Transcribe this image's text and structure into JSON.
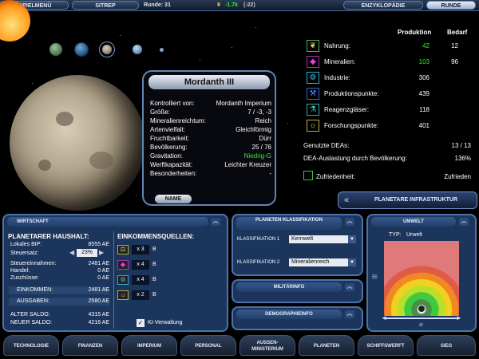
{
  "topbar": {
    "menu": "SPIELMENÜ",
    "sitrep": "SITREP",
    "round_label": "Runde: 31",
    "credits": "-1.7k",
    "credits_delta": "(-22)",
    "encyclopedia": "ENZYKLOPÄDIE",
    "round_button": "RUNDE"
  },
  "planet_info": {
    "name": "Mordanth III",
    "rows": [
      {
        "label": "Kontrolliert von:",
        "value": "Mordanth Imperium"
      },
      {
        "label": "Größe:",
        "value": "7 / -3, -3"
      },
      {
        "label": "Mineralienreichtum:",
        "value": "Reich"
      },
      {
        "label": "Artenvielfalt:",
        "value": "Gleichförmig"
      },
      {
        "label": "Fruchtbarkeit:",
        "value": "Dürr"
      },
      {
        "label": "Bevölkerung:",
        "value": "25 / 76"
      },
      {
        "label": "Gravitation:",
        "value": "Niedrig-G",
        "color": "#33ee33"
      },
      {
        "label": "Werftkapazität:",
        "value": "Leichter Kreuzer"
      },
      {
        "label": "Besonderheiten:",
        "value": "-"
      }
    ],
    "name_button": "NAME"
  },
  "production": {
    "col_production": "Produktion",
    "col_demand": "Bedarf",
    "rows": [
      {
        "icon": "food-icon",
        "label": "Nahrung:",
        "prod": "42",
        "demand": "12",
        "prod_color": "#33ee33"
      },
      {
        "icon": "minerals-icon",
        "label": "Mineralien:",
        "prod": "103",
        "demand": "96",
        "prod_color": "#33ee33"
      },
      {
        "icon": "industry-icon",
        "label": "Industrie:",
        "prod": "306",
        "demand": ""
      },
      {
        "icon": "production-points-icon",
        "label": "Produktionspunkte:",
        "prod": "439",
        "demand": ""
      },
      {
        "icon": "test-tubes-icon",
        "label": "Reagenzgläser:",
        "prod": "118",
        "demand": ""
      },
      {
        "icon": "research-icon",
        "label": "Forschungspunkte:",
        "prod": "401",
        "demand": ""
      }
    ],
    "dea_used_label": "Genutzte DEAs:",
    "dea_used_value": "13 / 13",
    "dea_load_label": "DEA-Auslastung durch Bevölkerung:",
    "dea_load_value": "136%",
    "satisfaction_label": "Zufriedenheit:",
    "satisfaction_value": "Zufrieden",
    "infra_button": "PLANETARE INFRASTRUKTUR"
  },
  "economy": {
    "header": "WIRTSCHAFT",
    "budget_title": "PLANETARER HAUSHALT:",
    "gdp_label": "Lokales BIP:",
    "gdp_value": "8555 AE",
    "tax_label": "Steuersatz:",
    "tax_value": "23%",
    "tax_income_label": "Steuereinnahmen:",
    "tax_income_value": "2481 AE",
    "trade_label": "Handel:",
    "trade_value": "0 AE",
    "subsidy_label": "Zuschüsse:",
    "subsidy_value": "0 AE",
    "income_label": "EINKOMMEN:",
    "income_value": "2481 AE",
    "expense_label": "AUSGABEN:",
    "expense_value": "2580 AE",
    "old_balance_label": "ALTER SALDO:",
    "old_balance_value": "4315 AE",
    "new_balance_label": "NEUER SALDO:",
    "new_balance_value": "4216 AE",
    "sources_title": "EINKOMMENSQUELLEN:",
    "sources": [
      {
        "icon": "trade-icon",
        "count": "x 3",
        "grade": "B"
      },
      {
        "icon": "minerals-icon",
        "count": "x 4",
        "grade": "B"
      },
      {
        "icon": "industry-icon",
        "count": "x 4",
        "grade": "B"
      },
      {
        "icon": "research-icon",
        "count": "x 2",
        "grade": "B"
      }
    ],
    "ai_label": "KI-Verwaltung"
  },
  "classification": {
    "header": "PLANETEN KLASSIFIKATION",
    "class1_label": "KLASSIFIKATION 1",
    "class1_value": "Kernwelt",
    "class2_label": "KLASSIFIKATION 2",
    "class2_value": "Mineralienreich",
    "military": "MILITÄRINFO",
    "demography": "DEMOGRAPHIEINFO"
  },
  "environment": {
    "header": "UMWELT",
    "type_label": "TYP:",
    "type_value": "Urwelt"
  },
  "nav": [
    "TECHNOLOGIE",
    "FINANZEN",
    "IMPERIUM",
    "PERSONAL",
    "AUSSEN-MINISTERIUM",
    "PLANETEN",
    "SCHIFFSWERFT",
    "SIEG"
  ],
  "colors": {
    "accent": "#4d73ac",
    "panel": "#1c355c",
    "green": "#33ee33"
  }
}
